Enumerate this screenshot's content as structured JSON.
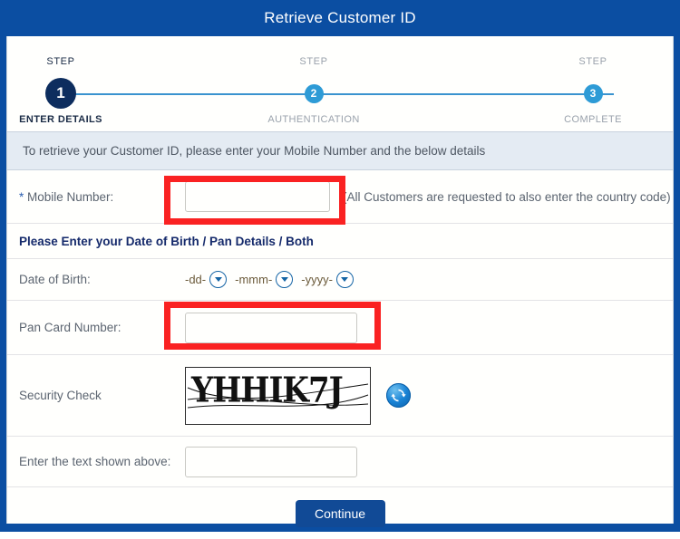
{
  "window": {
    "title": "Retrieve Customer ID"
  },
  "stepper": {
    "steps": [
      {
        "caption": "STEP",
        "number": "1",
        "label": "ENTER DETAILS"
      },
      {
        "caption": "STEP",
        "number": "2",
        "label": "AUTHENTICATION"
      },
      {
        "caption": "STEP",
        "number": "3",
        "label": "COMPLETE"
      }
    ]
  },
  "info": {
    "text": "To retrieve your Customer ID, please enter your Mobile Number and the below details"
  },
  "form": {
    "mobile": {
      "label_asterisk": "*",
      "label": " Mobile Number:",
      "value": "",
      "placeholder": "",
      "hint": "(All Customers are requested to also enter the country code)"
    },
    "headline": "Please Enter your Date of Birth / Pan Details / Both",
    "dob": {
      "label": "Date of Birth:",
      "day": "-dd-",
      "month": "-mmm-",
      "year": "-yyyy-"
    },
    "pan": {
      "label": "Pan Card Number:",
      "value": "",
      "placeholder": ""
    },
    "security": {
      "label": "Security Check",
      "captcha_text": "YHHIK7J",
      "refresh_icon": "refresh-icon"
    },
    "captcha_entry": {
      "label": "Enter the text shown above:",
      "value": "",
      "placeholder": ""
    }
  },
  "footer": {
    "continue_label": "Continue"
  },
  "colors": {
    "header_blue": "#0b4ea2",
    "step_active": "#0d2d5e",
    "step_inactive": "#2e9bd6",
    "info_bg": "#e4ebf3",
    "headline": "#152a6b",
    "annotation_red": "#fa2222",
    "button_blue": "#114a96"
  }
}
